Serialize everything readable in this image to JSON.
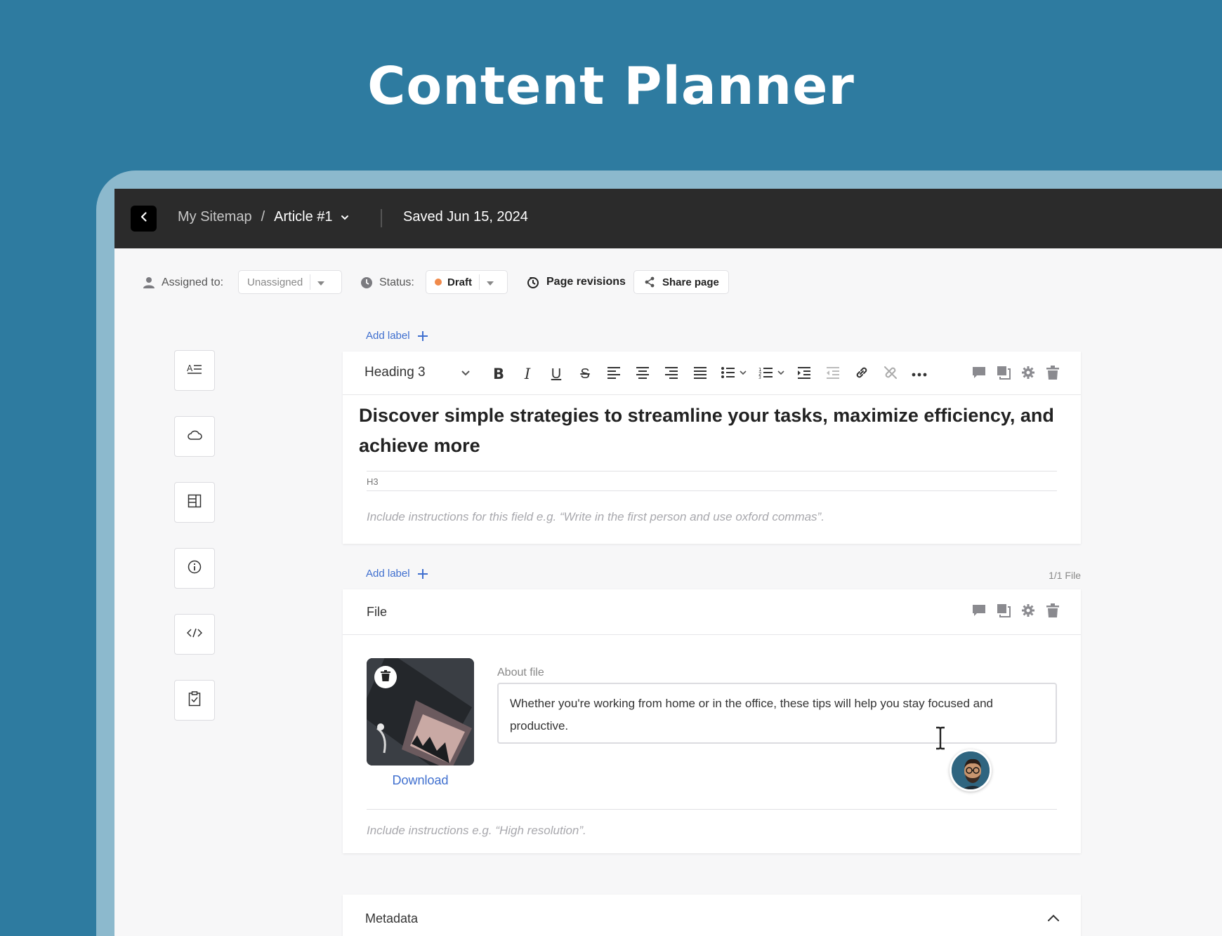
{
  "hero": {
    "title": "Content Planner"
  },
  "topbar": {
    "crumb_root": "My Sitemap",
    "crumb_sep": "/",
    "crumb_current": "Article #1",
    "saved": "Saved Jun 15, 2024"
  },
  "toolbar": {
    "assigned_label": "Assigned to:",
    "assigned_value": "Unassigned",
    "status_label": "Status:",
    "status_value": "Draft",
    "status_color": "#f08a4b",
    "revisions_label": "Page revisions",
    "share_label": "Share page"
  },
  "sidebar": {
    "items": [
      {
        "icon": "text-block-icon"
      },
      {
        "icon": "cloud-icon"
      },
      {
        "icon": "layout-icon"
      },
      {
        "icon": "info-icon"
      },
      {
        "icon": "code-icon"
      },
      {
        "icon": "clipboard-check-icon"
      }
    ]
  },
  "heading_card": {
    "add_label": "Add label",
    "heading_style": "Heading 3",
    "text": "Discover simple strategies to streamline your tasks, maximize efficiency, and achieve more",
    "tag": "H3",
    "instructions": "Include instructions for this field e.g. “Write in the first person and use oxford commas”."
  },
  "file_card": {
    "add_label": "Add label",
    "count": "1/1 File",
    "title": "File",
    "download": "Download",
    "about_label": "About file",
    "about_text": "Whether you're working from home or in the office, these tips will help you stay focused and productive.",
    "instructions": "Include instructions e.g. “High resolution”."
  },
  "metadata": {
    "title": "Metadata"
  },
  "colors": {
    "accent": "#3f6fcf",
    "background": "#2e7ba0",
    "topbar": "#2b2b2b"
  }
}
